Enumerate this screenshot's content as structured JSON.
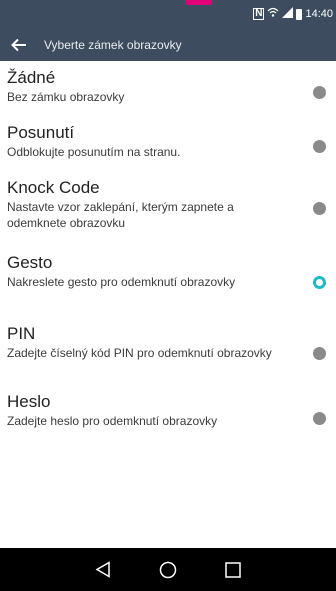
{
  "status_bar": {
    "time": "14:40",
    "icons": [
      "nfc-icon",
      "wifi-calling-icon",
      "signal-icon",
      "battery-icon"
    ],
    "nfc_label": "N"
  },
  "app_bar": {
    "title": "Vyberte zámek obrazovky",
    "back_icon": "arrow-left-icon"
  },
  "options": [
    {
      "label": "Žádné",
      "summary": "Bez zámku obrazovky",
      "selected": false
    },
    {
      "label": "Posunutí",
      "summary": "Odblokujte posunutím na stranu.",
      "selected": false
    },
    {
      "label": "Knock Code",
      "summary": "Nastavte vzor zaklepání, kterým zapnete a odemknete obrazovku",
      "selected": false
    },
    {
      "label": "Gesto",
      "summary": "Nakreslete gesto pro odemknutí obrazovky",
      "selected": true
    },
    {
      "label": "PIN",
      "summary": "Zadejte číselný kód PIN pro odemknutí obrazovky",
      "selected": false
    },
    {
      "label": "Heslo",
      "summary": "Zadejte heslo pro odemknutí obrazovky",
      "selected": false
    }
  ],
  "nav_bar": {
    "buttons": [
      "back-triangle-icon",
      "home-circle-icon",
      "recents-square-icon"
    ]
  },
  "colors": {
    "bar_background": "#3d4c5e",
    "accent": "#1fb8c9",
    "radio_off": "#8a8a8a",
    "brand_mark": "#e2007a"
  }
}
